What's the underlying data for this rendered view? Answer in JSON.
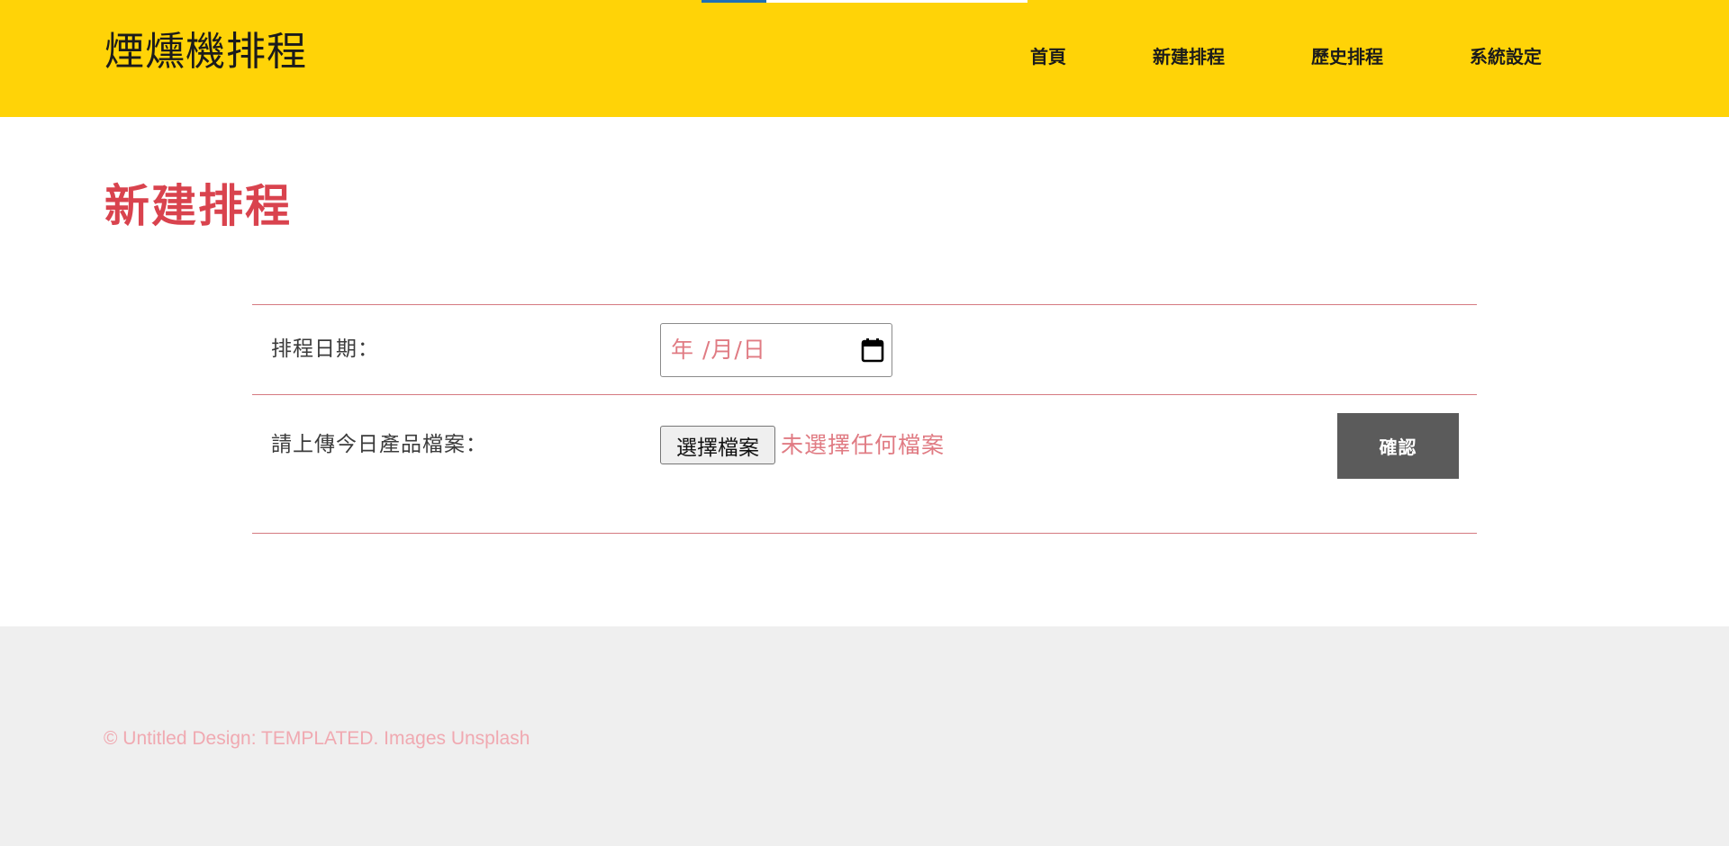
{
  "header": {
    "brand": "煙燻機排程",
    "nav": [
      {
        "label": "首頁"
      },
      {
        "label": "新建排程"
      },
      {
        "label": "歷史排程"
      },
      {
        "label": "系統設定"
      }
    ]
  },
  "main": {
    "title": "新建排程",
    "form": {
      "date_label": "排程日期：",
      "date_placeholder": "年 /月/日",
      "upload_label": "請上傳今日產品檔案：",
      "file_button_label": "選擇檔案",
      "file_status": "未選擇任何檔案",
      "confirm_label": "確認"
    }
  },
  "footer": {
    "copyright": "© Untitled Design: TEMPLATED. Images Unsplash"
  },
  "colors": {
    "header_bg": "#FFD307",
    "title": "#d9434e",
    "rule": "#d57a80",
    "placeholder": "#e07b83",
    "button_bg": "#5b5b5b",
    "footer_bg": "#efefef",
    "footer_text": "#f0a9b1"
  },
  "icons": {
    "date_picker": "calendar-icon"
  }
}
